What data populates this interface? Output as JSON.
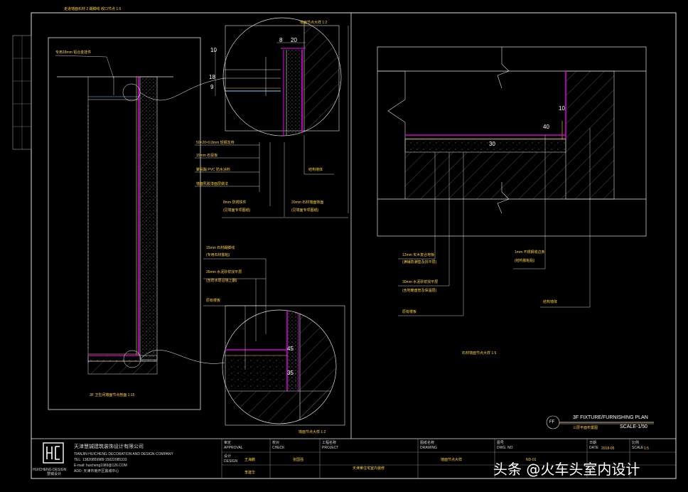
{
  "drawing": {
    "section_title_top": "走道墙面石材 2 踢脚线 收口节点 1:5",
    "detail_ref_top": "墙面节点大样 1:2",
    "detail_ref_bottom": "墙面节点大样 1:2",
    "detail_ref_right": "石材墙面节点大样 1:5",
    "section_left_caption": "3F 卫生间墙面节点剖面 1:15",
    "left_top_note": "专用18mm 铝合金挂件",
    "dims": {
      "d8": "8",
      "d20": "20",
      "d10a": "10",
      "d18": "18",
      "d9": "9",
      "d10b": "10",
      "d40": "40",
      "d30": "30",
      "d45": "45",
      "d35": "35"
    },
    "notes_upper_detail": [
      "50×20×0.8mm 轻钢龙骨",
      "15mm 石膏板",
      "聚氨酯 PVC 防水涂料",
      "墙面乳胶漆面层做法"
    ],
    "notes_upper_bottom_left": [
      "8mm 防锈铁件",
      "(见墙面专项图纸)"
    ],
    "notes_upper_bottom_right": [
      "20mm 石材墙面饰面",
      "(见墙面专项图纸)"
    ],
    "note_upper_right": "结构墙体",
    "notes_lower_detail": [
      "15mm 石材踢脚线",
      "(专用石材胶粘)",
      "35mm 水泥砂浆找平层",
      "(含防水层沿墙上翻)",
      "原有楼板"
    ],
    "notes_right": [
      "12mm 实木复合地板",
      "(满铺防潮垫及找平层)",
      "30mm 水泥砂浆找平层",
      "(含地暖盘管及保温层)",
      "原有楼板"
    ],
    "notes_right_top": [
      "1mm 不锈钢收边条",
      "(结构胶粘贴)"
    ],
    "note_right_wall": "结构墙体",
    "plan_title": "3F FIXTURE/FURNISHING PLAN",
    "plan_title_cn": "三层平面布置图",
    "plan_scale": "SCALE-1/50",
    "plan_badge": "FF",
    "firm_cn": "天津慧铖建筑装饰设计有限公司",
    "firm_en": "TIANJIN HUICHENG DECORATION AND DESIGN COMPANY",
    "firm_tel": "TEL: 13820859989  15022085333",
    "firm_email": "E-mail: huicheng1989@126.COM",
    "firm_addr": "ADD: 天津市南开区鼎城中心",
    "logo_text": "HUICHENG DESIGN",
    "logo_cn": "慧铖设计",
    "tb_labels": [
      "审定",
      "APPROVAL",
      "设计",
      "DESIGN",
      "校对",
      "CHECK",
      "工程名称",
      "PROJECT",
      "图纸名称",
      "DRAWING",
      "图号",
      "DWG. NO",
      "日期",
      "DATE",
      "比例",
      "SCALE"
    ],
    "tb_values": [
      "王海鹏",
      "李建华",
      "张国强",
      "天津某住宅室内装修",
      "墙面节点大样",
      "ND-01",
      "2018-05",
      "1:5"
    ],
    "watermark": "头条 @火车头室内设计"
  }
}
